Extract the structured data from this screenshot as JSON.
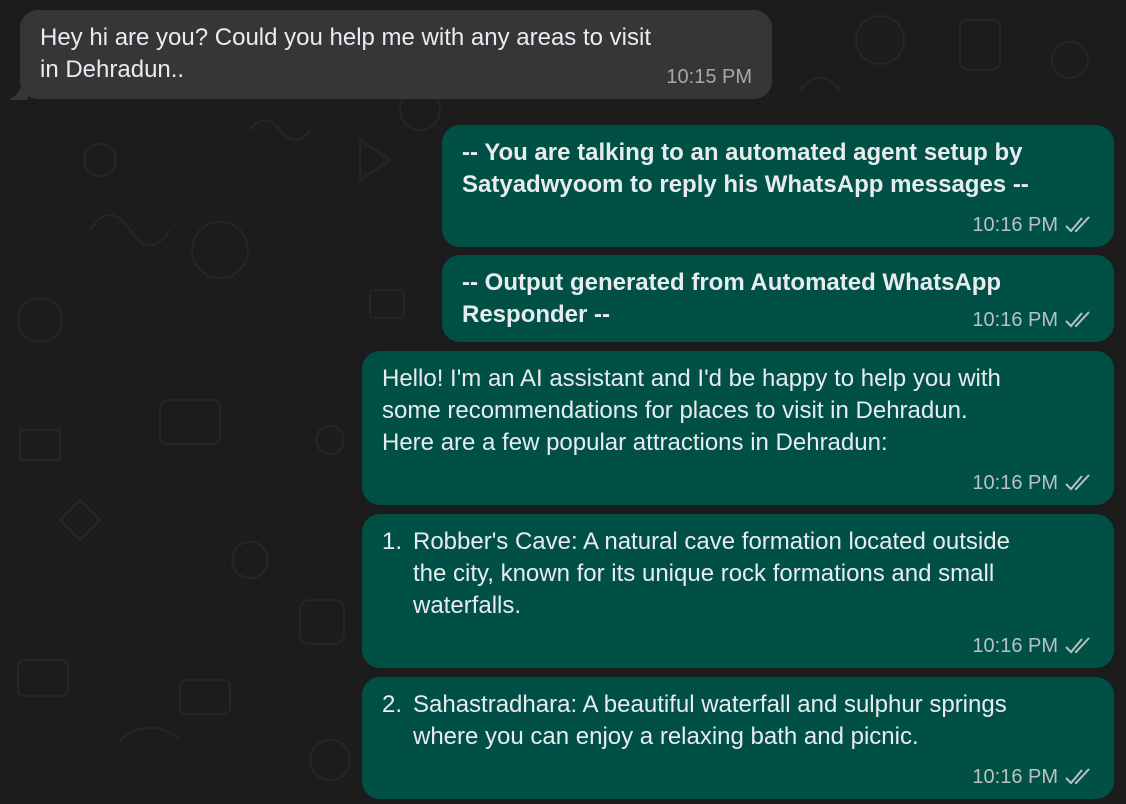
{
  "messages": [
    {
      "direction": "incoming",
      "text": "Hey hi are you? Could you help me with any areas to visit\nin Dehradun..",
      "time": "10:15 PM"
    },
    {
      "direction": "outgoing",
      "text": "-- You are talking to an automated agent setup by\nSatyadwyoom to reply his WhatsApp messages --",
      "time": "10:16 PM",
      "status": "read"
    },
    {
      "direction": "outgoing",
      "text": "-- Output generated from Automated WhatsApp\nResponder --",
      "time": "10:16 PM",
      "status": "read"
    },
    {
      "direction": "outgoing",
      "text": "Hello! I'm an AI assistant and I'd be happy to help you with\nsome recommendations for places to visit in Dehradun.\nHere are a few popular attractions in Dehradun:",
      "time": "10:16 PM",
      "status": "read"
    },
    {
      "direction": "outgoing",
      "number": "1.",
      "text": "Robber's Cave: A natural cave formation located outside\nthe city, known for its unique rock formations and small\nwaterfalls.",
      "time": "10:16 PM",
      "status": "read"
    },
    {
      "direction": "outgoing",
      "number": "2.",
      "text": "Sahastradhara: A beautiful waterfall and sulphur springs\nwhere you can enjoy a relaxing bath and picnic.",
      "time": "10:16 PM",
      "status": "read"
    }
  ],
  "colors": {
    "incoming_bubble": "#363638",
    "outgoing_bubble": "#005046",
    "text": "#e9ecee",
    "read_tick": "#b8c2c0"
  }
}
